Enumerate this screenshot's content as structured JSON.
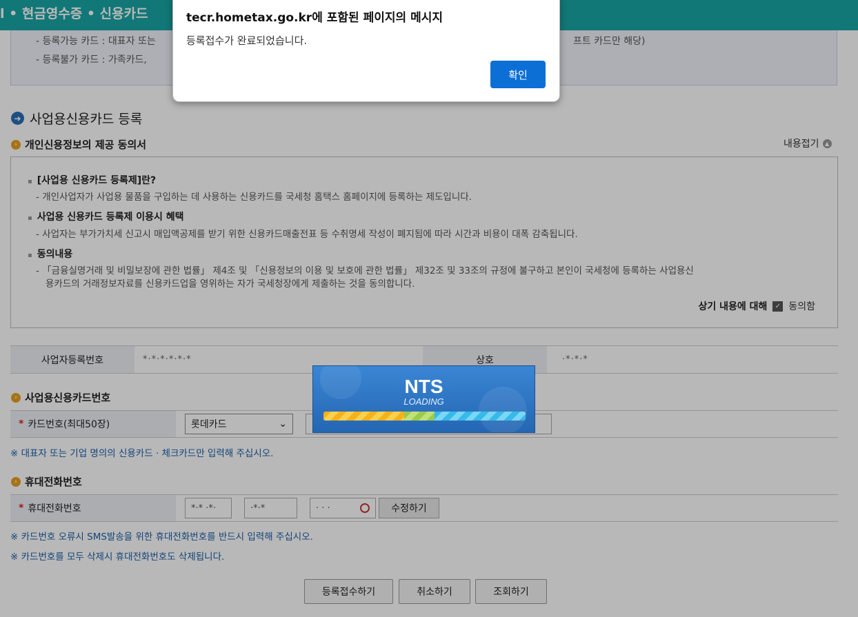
{
  "header": {
    "title": "l • 현금영수증 • 신용카드"
  },
  "notice": {
    "line1": "- 등록가능 카드 : 대표자 또는",
    "line1_tail": "프트 카드만 해당)",
    "line2": "- 등록불가 카드 : 가족카드,"
  },
  "section": {
    "title": "사업용신용카드 등록"
  },
  "consent": {
    "title": "개인신용정보의 제공 동의서",
    "collapse_label": "내용접기",
    "h1": "[사업용 신용카드 등록제]란?",
    "t1": "- 개인사업자가 사업용 물품을 구입하는 데 사용하는 신용카드를 국세청 홈택스 홈페이지에 등록하는 제도입니다.",
    "h2": "사업용 신용카드 등록제 이용시 혜택",
    "t2": "- 사업자는 부가가치세 신고시 매입액공제를 받기 위한 신용카드매출전표 등 수취명세 작성이 폐지됨에 따라 시간과 비용이 대폭 감축됩니다.",
    "h3": "동의내용",
    "t3a": "- 「금융실명거래 및 비밀보장에 관한 법률」 제4조 및 「신용정보의 이용 및 보호에 관한 법률」 제32조 및 33조의 규정에 불구하고 본인이 국세청에 등록하는 사업용신",
    "t3b": "용카드의   거래정보자료를 신용카드업을 영위하는 자가 국세청장에게 제출하는 것을 동의합니다.",
    "agree_prefix": "상기 내용에 대해",
    "agree_label": "동의함"
  },
  "business": {
    "reg_no_label": "사업자등록번호",
    "reg_no_value": "*·*·*·*·*·*",
    "name_label": "상호",
    "name_value": "·*·*·*"
  },
  "card": {
    "title": "사업용신용카드번호",
    "label": "카드번호(최대50장)",
    "select_value": "롯데카드",
    "note": "※ 대표자 또는 기업 명의의 신용카드 · 체크카드만 입력해 주십시오."
  },
  "phone": {
    "title": "휴대전화번호",
    "label": "휴대전화번호",
    "part1": "*·* ·*·",
    "part2": "·*·*",
    "part3": "· · ·",
    "edit_button": "수정하기",
    "note1": "※ 카드번호 오류시 SMS발송을 위한 휴대전화번호를 반드시 입력해 주십시오.",
    "note2": "※ 카드번호를 모두 삭제시 휴대전화번호도 삭제됩니다."
  },
  "actions": {
    "submit": "등록접수하기",
    "cancel": "취소하기",
    "lookup": "조회하기"
  },
  "dialog": {
    "title": "tecr.hometax.go.kr에 포함된 페이지의 메시지",
    "message": "등록접수가 완료되었습니다.",
    "ok": "확인"
  },
  "loading": {
    "brand": "NTS",
    "text": "LOADING"
  }
}
